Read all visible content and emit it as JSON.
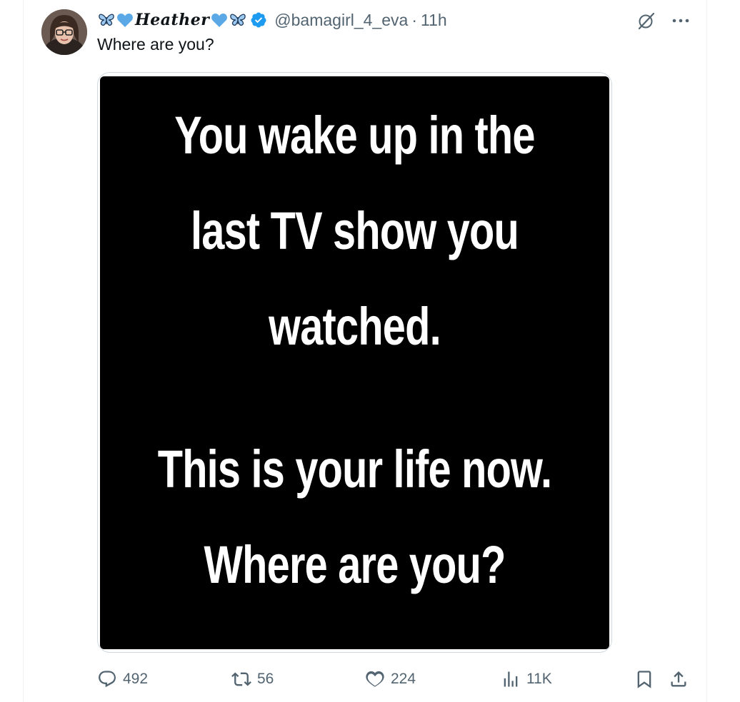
{
  "tweet": {
    "author": {
      "display_name": "Heather",
      "handle": "@bamagirl_4_eva",
      "verified": true,
      "name_emoji_left": [
        "butterfly-icon",
        "blue-heart-icon"
      ],
      "name_emoji_right": [
        "blue-heart-icon",
        "butterfly-icon"
      ]
    },
    "separator": "·",
    "time": "11h",
    "text": "Where are you?",
    "image_lines": [
      "You wake up in the",
      "last TV show you",
      "watched.",
      "This is your life now.",
      "Where are you?"
    ],
    "actions": {
      "replies": "492",
      "reposts": "56",
      "likes": "224",
      "views": "11K"
    }
  },
  "colors": {
    "text_primary": "#0f1419",
    "text_secondary": "#536471",
    "verified_blue": "#1d9bf0",
    "heart_blue": "#5aa9e6",
    "image_background": "#000000"
  },
  "icons": {
    "top_right": [
      "grok-icon",
      "more-icon"
    ],
    "action_bar": [
      "reply-icon",
      "repost-icon",
      "like-icon",
      "views-icon",
      "bookmark-icon",
      "share-icon"
    ]
  }
}
